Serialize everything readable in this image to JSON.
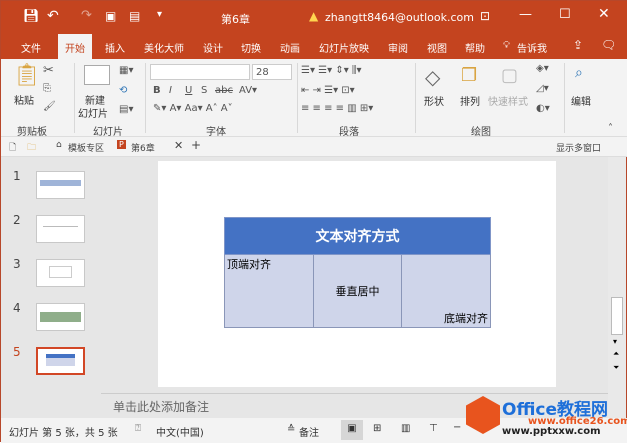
{
  "titlebar": {
    "doc_title": "第6章",
    "account": "zhangtt8464@outlook.com",
    "accent": "#c4441f"
  },
  "tabs": [
    "文件",
    "开始",
    "插入",
    "美化大师",
    "设计",
    "切换",
    "动画",
    "幻灯片放映",
    "审阅",
    "视图",
    "帮助",
    "告诉我"
  ],
  "ribbon": {
    "paste": "粘贴",
    "new_slide": "新建",
    "new_slide2": "幻灯片",
    "font_size": "28",
    "shapes": "形状",
    "arrange": "排列",
    "quick_styles": "快速样式",
    "edit": "编辑",
    "groups": [
      "剪贴板",
      "幻灯片",
      "字体",
      "段落",
      "绘图"
    ]
  },
  "doctabs": {
    "template": "模板专区",
    "doc": "第6章",
    "multi_window": "显示多窗口"
  },
  "slides": {
    "numbers": [
      "1",
      "2",
      "3",
      "4",
      "5"
    ],
    "current": "5"
  },
  "table": {
    "header": "文本对齐方式",
    "cells": [
      "顶端对齐",
      "垂直居中",
      "底端对齐"
    ],
    "header_color": "#4472c4",
    "cell_color": "#cfd5ea"
  },
  "notes": "单击此处添加备注",
  "status": {
    "slide_info": "幻灯片 第 5 张，共 5 张",
    "language": "中文(中国)",
    "notes": "备注"
  },
  "watermark": {
    "brand": "Office教程网",
    "url1": "www.office26.com",
    "url2": "www.pptxxw.com"
  }
}
